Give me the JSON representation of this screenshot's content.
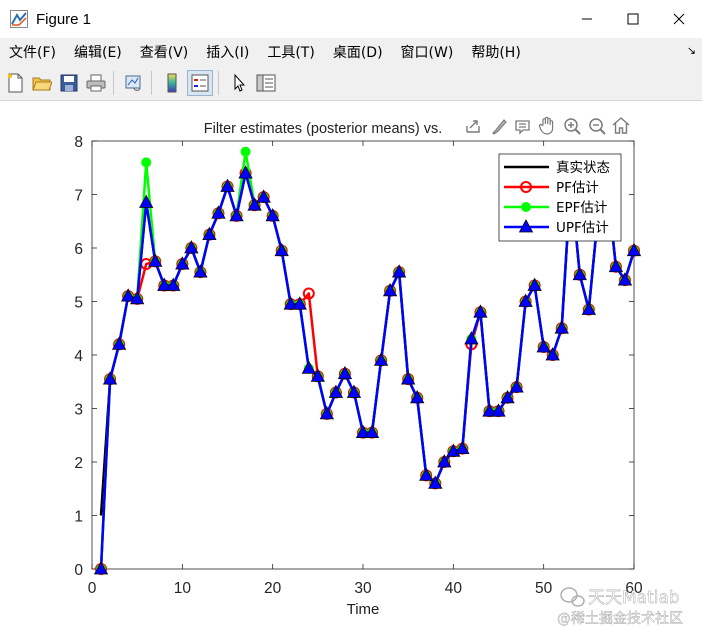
{
  "window": {
    "title": "Figure 1",
    "controls": [
      "minimize-icon",
      "maximize-icon",
      "close-icon"
    ]
  },
  "menu": {
    "items": [
      "文件(F)",
      "编辑(E)",
      "查看(V)",
      "插入(I)",
      "工具(T)",
      "桌面(D)",
      "窗口(W)",
      "帮助(H)"
    ],
    "overflow": "↘"
  },
  "toolbar": {
    "icons": [
      "new-figure-icon",
      "open-file-icon",
      "save-icon",
      "print-icon",
      "link-plot-icon",
      "colorbar-icon",
      "legend-icon",
      "pointer-icon",
      "property-inspector-icon"
    ]
  },
  "axes_toolbar": {
    "icons": [
      "export-icon",
      "brush-icon",
      "data-tips-icon",
      "pan-icon",
      "zoom-in-icon",
      "zoom-out-icon",
      "home-icon"
    ]
  },
  "watermark": {
    "line1": "天天Matlab",
    "line2": "@稀土掘金技术社区"
  },
  "colors": {
    "true_state": "#000000",
    "pf": "#ff0000",
    "epf": "#00ff00",
    "upf": "#0000ff"
  },
  "chart_data": {
    "type": "line",
    "title": "Filter estimates (posterior means) vs.",
    "xlabel": "Time",
    "ylabel": "",
    "xlim": [
      0,
      60
    ],
    "ylim": [
      0,
      8
    ],
    "xticks": [
      0,
      10,
      20,
      30,
      40,
      50,
      60
    ],
    "yticks": [
      0,
      1,
      2,
      3,
      4,
      5,
      6,
      7,
      8
    ],
    "legend_position": "top-right",
    "x": [
      1,
      2,
      3,
      4,
      5,
      6,
      7,
      8,
      9,
      10,
      11,
      12,
      13,
      14,
      15,
      16,
      17,
      18,
      19,
      20,
      21,
      22,
      23,
      24,
      25,
      26,
      27,
      28,
      29,
      30,
      31,
      32,
      33,
      34,
      35,
      36,
      37,
      38,
      39,
      40,
      41,
      42,
      43,
      44,
      45,
      46,
      47,
      48,
      49,
      50,
      51,
      52,
      53,
      54,
      55,
      56,
      57,
      58,
      59,
      60
    ],
    "series": [
      {
        "name": "真实状态",
        "marker": "none",
        "values": [
          1.0,
          3.55,
          4.2,
          5.1,
          5.05,
          6.85,
          5.75,
          5.3,
          5.3,
          5.7,
          6.0,
          5.55,
          6.25,
          6.65,
          7.15,
          6.6,
          7.4,
          6.8,
          6.95,
          6.6,
          5.95,
          4.95,
          4.95,
          3.75,
          3.6,
          2.9,
          3.3,
          3.65,
          3.3,
          2.55,
          2.55,
          3.9,
          5.2,
          5.55,
          3.55,
          3.2,
          1.75,
          1.6,
          2.0,
          2.2,
          2.25,
          4.3,
          4.8,
          2.95,
          2.95,
          3.2,
          3.4,
          5.0,
          5.3,
          4.15,
          4.0,
          4.5,
          7.25,
          5.5,
          4.85,
          6.6,
          7.25,
          5.65,
          5.4,
          5.95
        ]
      },
      {
        "name": "PF估计",
        "marker": "circle",
        "values": [
          0.0,
          3.55,
          4.2,
          5.1,
          5.05,
          5.7,
          5.75,
          5.3,
          5.3,
          5.7,
          6.0,
          5.55,
          6.25,
          6.65,
          7.15,
          6.6,
          7.4,
          6.8,
          6.95,
          6.6,
          5.95,
          4.95,
          4.95,
          5.15,
          3.6,
          2.9,
          3.3,
          3.65,
          3.3,
          2.55,
          2.55,
          3.9,
          5.2,
          5.55,
          3.55,
          3.2,
          1.75,
          1.6,
          2.0,
          2.2,
          2.25,
          4.2,
          4.8,
          2.95,
          2.95,
          3.2,
          3.4,
          5.0,
          5.3,
          4.15,
          4.0,
          4.5,
          7.25,
          5.5,
          4.85,
          6.6,
          7.25,
          5.65,
          5.4,
          5.95
        ]
      },
      {
        "name": "EPF估计",
        "marker": "dot",
        "values": [
          0.0,
          3.55,
          4.2,
          5.1,
          5.05,
          7.6,
          5.75,
          5.3,
          5.3,
          5.7,
          6.0,
          5.55,
          6.25,
          6.65,
          7.15,
          6.6,
          7.8,
          6.8,
          6.95,
          6.6,
          5.95,
          4.95,
          4.95,
          3.75,
          3.6,
          2.9,
          3.3,
          3.65,
          3.3,
          2.55,
          2.55,
          3.9,
          5.2,
          5.55,
          3.55,
          3.2,
          1.75,
          1.6,
          2.0,
          2.2,
          2.25,
          4.3,
          4.8,
          2.95,
          2.95,
          3.2,
          3.4,
          5.0,
          5.3,
          4.15,
          4.0,
          4.5,
          7.25,
          5.5,
          4.85,
          6.6,
          7.25,
          5.65,
          5.4,
          5.95
        ]
      },
      {
        "name": "UPF估计",
        "marker": "triangle",
        "values": [
          0.0,
          3.55,
          4.2,
          5.1,
          5.05,
          6.85,
          5.75,
          5.3,
          5.3,
          5.7,
          6.0,
          5.55,
          6.25,
          6.65,
          7.15,
          6.6,
          7.4,
          6.8,
          6.95,
          6.6,
          5.95,
          4.95,
          4.95,
          3.75,
          3.6,
          2.9,
          3.3,
          3.65,
          3.3,
          2.55,
          2.55,
          3.9,
          5.2,
          5.55,
          3.55,
          3.2,
          1.75,
          1.6,
          2.0,
          2.2,
          2.25,
          4.3,
          4.8,
          2.95,
          2.95,
          3.2,
          3.4,
          5.0,
          5.3,
          4.15,
          4.0,
          4.5,
          7.25,
          5.5,
          4.85,
          6.6,
          7.25,
          5.65,
          5.4,
          5.95
        ]
      }
    ]
  }
}
